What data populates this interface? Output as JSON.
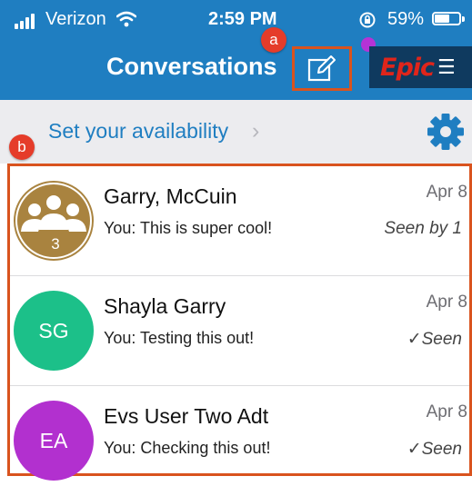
{
  "status_bar": {
    "carrier": "Verizon",
    "time": "2:59 PM",
    "battery": "59%",
    "battery_fraction": 0.59
  },
  "header": {
    "title": "Conversations",
    "compose_icon": "compose-icon",
    "epic_logo": "Epic",
    "menu_icon": "menu-icon",
    "accent_color": "#1f7ec1",
    "highlight_color": "#d9531e"
  },
  "callouts": {
    "a": "a",
    "b": "b"
  },
  "availability": {
    "label": "Set your availability",
    "chevron": "›",
    "settings_icon": "gear-icon"
  },
  "conversations": [
    {
      "name": "Garry, McCuin",
      "date": "Apr 8",
      "preview": "You: This is super cool!",
      "status": "Seen by 1",
      "avatar_type": "group",
      "avatar_count": "3",
      "avatar_color": "#a9833f"
    },
    {
      "name": "Shayla Garry",
      "date": "Apr 8",
      "preview": "You: Testing this out!",
      "status": "✓Seen",
      "avatar_type": "initials",
      "avatar_initials": "SG",
      "avatar_color": "#1cc089"
    },
    {
      "name": "Evs User Two Adt",
      "date": "Apr 8",
      "preview": "You: Checking this out!",
      "status": "✓Seen",
      "avatar_type": "initials",
      "avatar_initials": "EA",
      "avatar_color": "#b230cf"
    }
  ]
}
